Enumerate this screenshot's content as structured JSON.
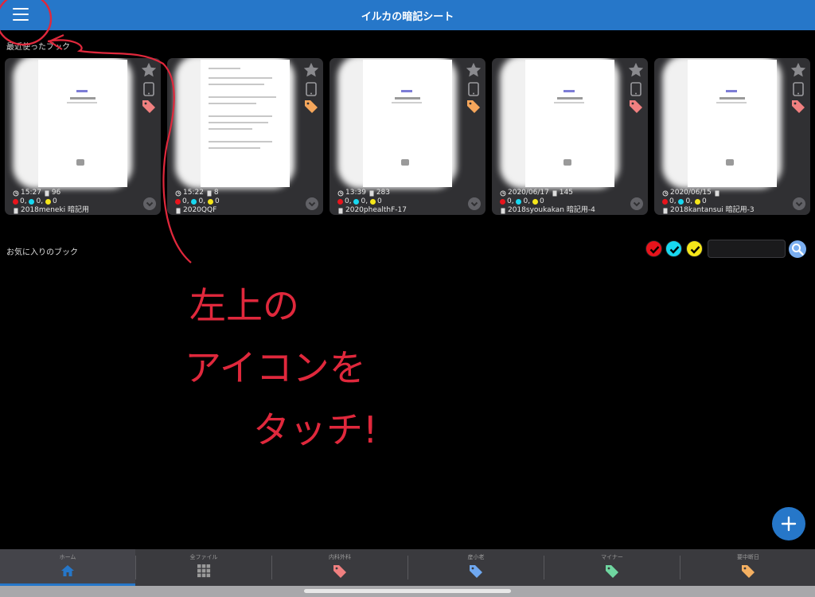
{
  "header": {
    "title": "イルカの暗記シート"
  },
  "recent": {
    "label": "最近使ったブック",
    "cards": [
      {
        "time": "15:27",
        "pages": "96",
        "red": "0",
        "cyan": "0",
        "yellow": "0",
        "name": "2018meneki 暗記用",
        "tag_color": "#f08080"
      },
      {
        "time": "15:22",
        "pages": "8",
        "red": "0",
        "cyan": "0",
        "yellow": "0",
        "name": "2020QQF",
        "tag_color": "#f5a65b"
      },
      {
        "time": "13:39",
        "pages": "283",
        "red": "0",
        "cyan": "0",
        "yellow": "0",
        "name": "2020phealthF-17",
        "tag_color": "#f5a65b"
      },
      {
        "time": "2020/06/17",
        "pages": "145",
        "red": "0",
        "cyan": "0",
        "yellow": "0",
        "name": "2018syoukakan 暗記用-4",
        "tag_color": "#f08080"
      },
      {
        "time": "2020/06/15",
        "pages": "",
        "red": "0",
        "cyan": "0",
        "yellow": "0",
        "name": "2018kantansui 暗記用-3",
        "tag_color": "#f08080"
      }
    ]
  },
  "favorites": {
    "label": "お気に入りのブック",
    "search_value": ""
  },
  "filter_colors": {
    "red": "#e8141c",
    "cyan": "#18d8f0",
    "yellow": "#f5e61a"
  },
  "tabs": [
    {
      "label": "ホーム",
      "icon": "home-icon",
      "color": "#2677c9"
    },
    {
      "label": "全ファイル",
      "icon": "grid-icon",
      "color": "#9a9a9a"
    },
    {
      "label": "内科外科",
      "icon": "tag-icon",
      "color": "#f08080"
    },
    {
      "label": "産小老",
      "icon": "tag-icon",
      "color": "#6fa8f0"
    },
    {
      "label": "マイナー",
      "icon": "tag-icon",
      "color": "#6fd6a0"
    },
    {
      "label": "要中断日",
      "icon": "tag-icon",
      "color": "#f5b061"
    }
  ],
  "annotation": {
    "lines": [
      "左上の",
      "アイコンを",
      "タッチ!"
    ],
    "color": "#e0283c"
  },
  "colors": {
    "accent": "#2677c9",
    "card": "#303033",
    "background": "#000000"
  }
}
